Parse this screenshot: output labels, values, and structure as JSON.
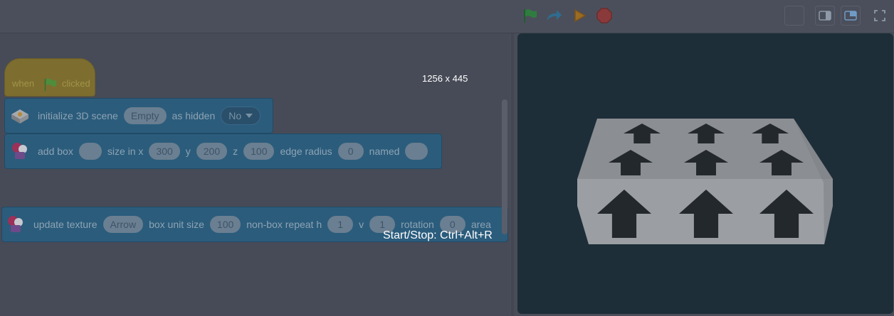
{
  "stage_size_label": "1256 x 445",
  "shortcut_hint": "Start/Stop: Ctrl+Alt+R",
  "hat_block": {
    "before": "when",
    "after": "clicked"
  },
  "blocks": {
    "init_scene": {
      "label_pre": "initialize 3D scene",
      "scene_value": "Empty",
      "label_mid": "as hidden",
      "hidden_value": "No"
    },
    "add_box": {
      "label": "add box",
      "size_in_x": "size in x",
      "x_value": "300",
      "y_label": "y",
      "y_value": "200",
      "z_label": "z",
      "z_value": "100",
      "edge_radius_label": "edge radius",
      "edge_radius_value": "0",
      "named_label": "named"
    },
    "update_texture": {
      "label": "update texture",
      "texture_value": "Arrow",
      "unit_size_label": "box unit size",
      "unit_size_value": "100",
      "repeat_label": "non-box repeat h",
      "h_value": "1",
      "v_label": "v",
      "v_value": "1",
      "rotation_label": "rotation",
      "rotation_value": "0",
      "area_label": "area"
    }
  },
  "icons": {
    "flag": "green-flag-icon",
    "redo": "redo-icon",
    "run": "run-icon",
    "stop": "stop-icon",
    "small_stage": "small-stage-icon",
    "large_stage": "large-stage-icon",
    "fullscreen": "fullscreen-icon"
  },
  "colors": {
    "stage_bg": "#1d2e38",
    "block_blue": "#2b5c7c",
    "hat_yellow": "#7d6e30",
    "box_gray": "#8f9298"
  }
}
